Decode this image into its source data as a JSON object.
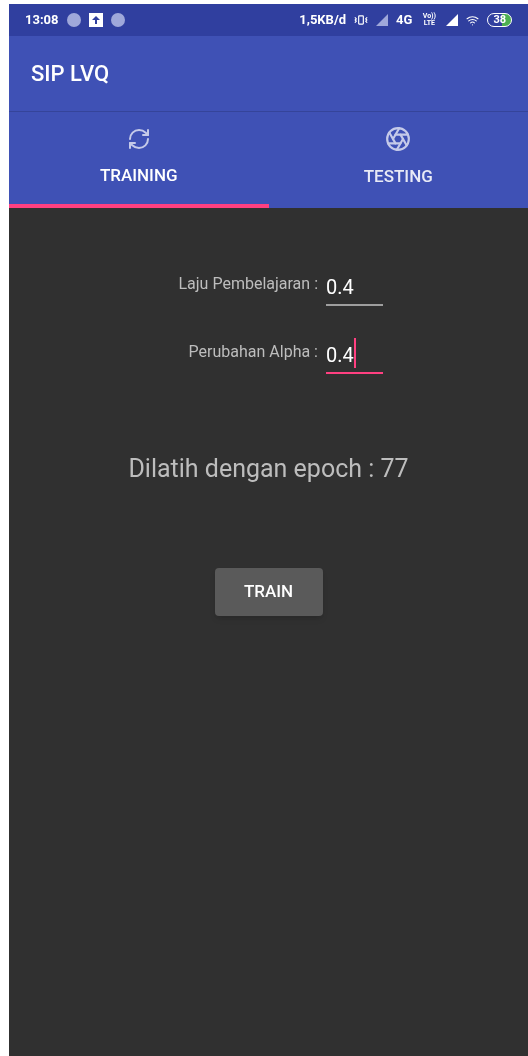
{
  "status_bar": {
    "time": "13:08",
    "network_speed": "1,5KB/d",
    "network_type": "4G",
    "volte": "Vo)) LTE",
    "battery": "38"
  },
  "app_bar": {
    "title": "SIP LVQ"
  },
  "tabs": [
    {
      "label": "TRAINING",
      "kind": "sync",
      "selected": true
    },
    {
      "label": "TESTING",
      "kind": "aperture",
      "selected": false
    }
  ],
  "fields": [
    {
      "label": "Laju Pembelajaran :",
      "value": "0.4",
      "focused": false
    },
    {
      "label": "Perubahan Alpha :",
      "value": "0.4",
      "focused": true
    }
  ],
  "result": "Dilatih dengan epoch : 77",
  "button": "TRAIN"
}
